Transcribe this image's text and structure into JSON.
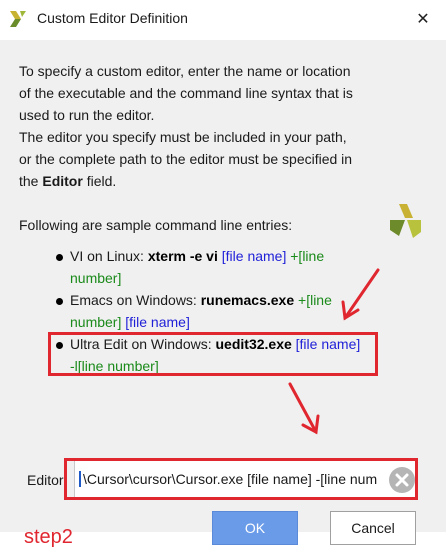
{
  "window": {
    "title": "Custom Editor Definition",
    "close_glyph": "✕"
  },
  "description": {
    "lines": [
      "To specify a custom editor, enter the name or location",
      "of the executable and the command line syntax that is",
      "used to run the editor.",
      "The editor you specify must be included in your path,",
      "or the complete path to the editor must be specified in"
    ],
    "last_prefix": "the ",
    "last_bold": "Editor",
    "last_suffix": " field."
  },
  "samples": {
    "heading": "Following are sample command line entries:",
    "items": [
      {
        "prefix": "VI on Linux: ",
        "cmd": "xterm -e vi",
        "file": "[file name]",
        "line": "+[line number]"
      },
      {
        "prefix": "Emacs on Windows: ",
        "cmd": "runemacs.exe",
        "line": "+[line number]",
        "file": "[file name]"
      },
      {
        "prefix": "Ultra Edit on Windows: ",
        "cmd": "uedit32.exe",
        "file": "[file name]",
        "line": "-l[line number]"
      }
    ]
  },
  "editor": {
    "label": "Editor:",
    "value": "\\Cursor\\cursor\\Cursor.exe [file name] -[line num"
  },
  "buttons": {
    "ok": "OK",
    "cancel": "Cancel"
  },
  "annotation": {
    "step_label": "step2"
  },
  "colors": {
    "accent": "#6a9be8",
    "annotation": "#e0262f",
    "file_placeholder": "#1f1fd8",
    "line_placeholder": "#1a8a1a"
  }
}
